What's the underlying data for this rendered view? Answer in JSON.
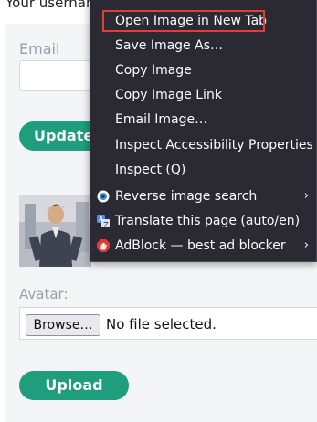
{
  "page": {
    "username_line": "Your username is: wiener"
  },
  "form": {
    "email_label": "Email",
    "update_button": "Update e",
    "avatar_label": "Avatar:",
    "browse_button": "Browse…",
    "file_status": "No file selected.",
    "upload_button": "Upload"
  },
  "context_menu": {
    "items": [
      {
        "label": "Open Image in New Tab",
        "highlighted": true
      },
      {
        "label": "Save Image As…"
      },
      {
        "label": "Copy Image"
      },
      {
        "label": "Copy Image Link"
      },
      {
        "label": "Email Image…"
      },
      {
        "label": "Inspect Accessibility Properties"
      },
      {
        "label": "Inspect (Q)"
      },
      {
        "label": "Reverse image search",
        "icon": "reverse-search-icon",
        "submenu": true
      },
      {
        "label": "Translate this page (auto/en)",
        "icon": "translate-icon"
      },
      {
        "label": "AdBlock — best ad blocker",
        "icon": "adblock-icon",
        "submenu": true
      }
    ],
    "highlight_color": "#e43c3c"
  },
  "colors": {
    "accent": "#1e9e7c",
    "menu_bg": "#2b2a33"
  }
}
